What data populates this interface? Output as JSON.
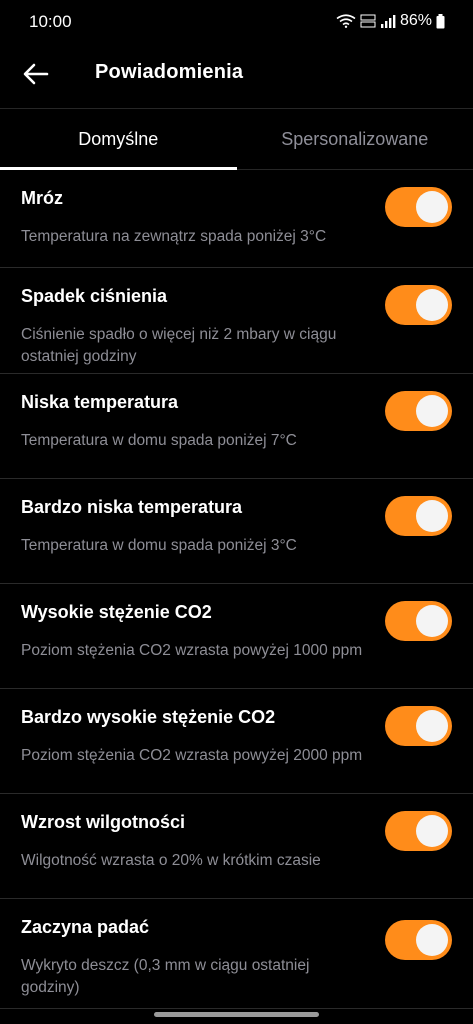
{
  "status": {
    "time": "10:00",
    "battery": "86%"
  },
  "header": {
    "title": "Powiadomienia",
    "back_icon": "arrow-left-icon"
  },
  "tabs": [
    {
      "label": "Domyślne",
      "active": true
    },
    {
      "label": "Spersonalizowane",
      "active": false
    }
  ],
  "colors": {
    "accent": "#ff8c1a",
    "background": "#000000",
    "secondary_text": "#8e8e96"
  },
  "notifications": [
    {
      "title": "Mróz",
      "description": "Temperatura na zewnątrz spada poniżej 3°C",
      "enabled": true
    },
    {
      "title": "Spadek ciśnienia",
      "description": "Ciśnienie spadło o więcej niż 2 mbary w ciągu ostatniej godziny",
      "enabled": true
    },
    {
      "title": "Niska temperatura",
      "description": "Temperatura w domu spada poniżej 7°C",
      "enabled": true
    },
    {
      "title": "Bardzo niska temperatura",
      "description": "Temperatura w domu spada poniżej 3°C",
      "enabled": true
    },
    {
      "title": "Wysokie stężenie CO2",
      "description": "Poziom stężenia CO2 wzrasta powyżej 1000 ppm",
      "enabled": true
    },
    {
      "title": "Bardzo wysokie stężenie CO2",
      "description": "Poziom stężenia CO2 wzrasta powyżej 2000 ppm",
      "enabled": true
    },
    {
      "title": "Wzrost wilgotności",
      "description": "Wilgotność wzrasta o 20% w krótkim czasie",
      "enabled": true
    },
    {
      "title": "Zaczyna padać",
      "description": "Wykryto deszcz (0,3 mm w ciągu ostatniej godziny)",
      "enabled": true
    }
  ]
}
